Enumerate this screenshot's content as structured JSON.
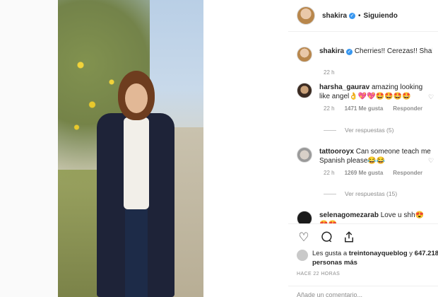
{
  "header": {
    "username": "shakira",
    "separator": "•",
    "follow_status": "Siguiendo"
  },
  "caption": {
    "username": "shakira",
    "text": "Cherries!! Cerezas!! Shak",
    "time": "22 h"
  },
  "comments": [
    {
      "username": "harsha_gaurav",
      "text": "amazing looking like angel👌💖💖🤩🤩🤩🤩",
      "time": "22 h",
      "likes": "1471 Me gusta",
      "reply": "Responder",
      "view_replies": "Ver respuestas (5)"
    },
    {
      "username": "tattooroyx",
      "text": "Can someone teach me Spanish please😂😂",
      "time": "22 h",
      "likes": "1269 Me gusta",
      "reply": "Responder",
      "view_replies": "Ver respuestas (15)"
    },
    {
      "username": "selenagomezarab",
      "text": "Love u shh😍",
      "partial": "😍😍..."
    }
  ],
  "likes": {
    "prefix": "Les gusta a ",
    "user": "treintonayqueblog",
    "middle": " y ",
    "count": "647.218 personas más"
  },
  "time_ago": "HACE 22 HORAS",
  "add_comment": "Añade un comentario..."
}
